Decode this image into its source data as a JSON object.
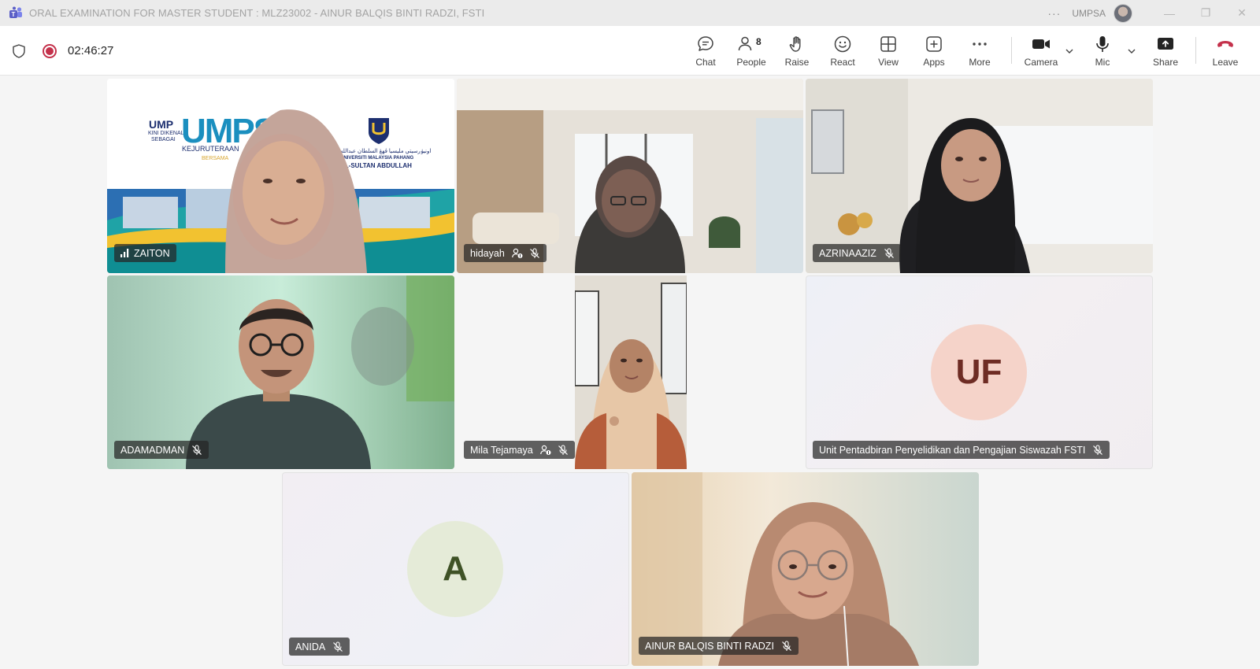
{
  "window": {
    "title": "ORAL EXAMINATION FOR MASTER STUDENT : MLZ23002 - AINUR BALQIS BINTI RADZI, FSTI",
    "more_label": "···",
    "org": "UMPSA",
    "minimize": "—",
    "restore": "❐",
    "close": "✕"
  },
  "meeting": {
    "elapsed": "02:46:27",
    "people_count": "8",
    "toolbar": [
      {
        "label": "Chat",
        "icon": "chat-icon"
      },
      {
        "label": "People",
        "icon": "people-icon"
      },
      {
        "label": "Raise",
        "icon": "hand-icon"
      },
      {
        "label": "React",
        "icon": "smiley-icon"
      },
      {
        "label": "View",
        "icon": "grid-icon"
      },
      {
        "label": "Apps",
        "icon": "plus-square-icon"
      },
      {
        "label": "More",
        "icon": "more-icon"
      },
      {
        "label": "Camera",
        "icon": "camera-icon"
      },
      {
        "label": "Mic",
        "icon": "mic-icon"
      },
      {
        "label": "Share",
        "icon": "share-icon"
      },
      {
        "label": "Leave",
        "icon": "phone-icon"
      }
    ]
  },
  "banner_text": {
    "ump": "UMP",
    "kini": "KINI DIKENALI",
    "sebagai": "SEBAGAI",
    "umpsa": "UMPSA",
    "kejuruteraan": "KEJURUTERAAN",
    "bersama": "BERSAMA",
    "univ_ar": "اونيۏرسيتي مليسيا ڤهڠ السلطان عبدالله",
    "univ_name": "UNIVERSITI MALAYSIA PAHANG",
    "univ_name2": "AL-SULTAN ABDULLAH"
  },
  "participants": [
    {
      "name": "ZAITON",
      "status": "speaking"
    },
    {
      "name": "hidayah",
      "status": "muted"
    },
    {
      "name": "AZRINAAZIZ",
      "status": "muted"
    },
    {
      "name": "ADAMADMAN",
      "status": "muted"
    },
    {
      "name": "Mila Tejamaya",
      "status": "muted"
    },
    {
      "name": "Unit Pentadbiran Penyelidikan dan Pengajian Siswazah FSTI",
      "initials": "UF",
      "status": "muted"
    },
    {
      "name": "ANIDA",
      "initials": "A",
      "status": "muted"
    },
    {
      "name": "AINUR BALQIS BINTI RADZI",
      "status": "muted"
    }
  ],
  "colors": {
    "accent": "#5b5fc7",
    "record": "#c4314b",
    "leave": "#c4314b",
    "uf_bg": "#f5d3c9",
    "uf_fg": "#6e2c24",
    "a_bg": "#e5ebd8",
    "a_fg": "#3f5226"
  }
}
